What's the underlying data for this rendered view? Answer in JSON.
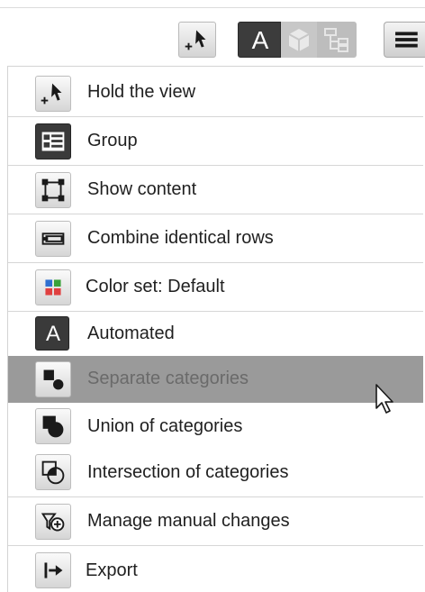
{
  "toolbar": {
    "buttons": [
      {
        "icon": "pointer-plus-icon"
      },
      {
        "icon": "automated-a-icon",
        "label": "A"
      },
      {
        "icon": "cube-icon"
      },
      {
        "icon": "tree-icon"
      },
      {
        "icon": "hamburger-menu-icon"
      }
    ]
  },
  "menu": {
    "items": [
      {
        "label": "Hold the view",
        "icon": "pointer-plus-icon"
      },
      {
        "label": "Group",
        "icon": "group-list-icon"
      },
      {
        "label": "Show content",
        "icon": "show-content-icon"
      },
      {
        "label": "Combine identical rows",
        "icon": "combine-rows-icon"
      },
      {
        "label": "Color set: Default",
        "icon": "color-set-icon"
      },
      {
        "label": "Automated",
        "icon": "automated-a-icon",
        "icon_text": "A"
      },
      {
        "label": "Separate categories",
        "icon": "separate-categories-icon",
        "selected": true
      },
      {
        "label": "Union of categories",
        "icon": "union-categories-icon"
      },
      {
        "label": "Intersection of categories",
        "icon": "intersection-categories-icon"
      },
      {
        "label": "Manage manual changes",
        "icon": "manage-changes-icon"
      },
      {
        "label": "Export",
        "icon": "export-icon"
      }
    ]
  },
  "colors": {
    "selected_row": "#9a9a9a",
    "dark_button": "#3c3c3c",
    "color_set": [
      "#2f6fd0",
      "#3aa23a",
      "#e04040",
      "#e04040"
    ]
  }
}
